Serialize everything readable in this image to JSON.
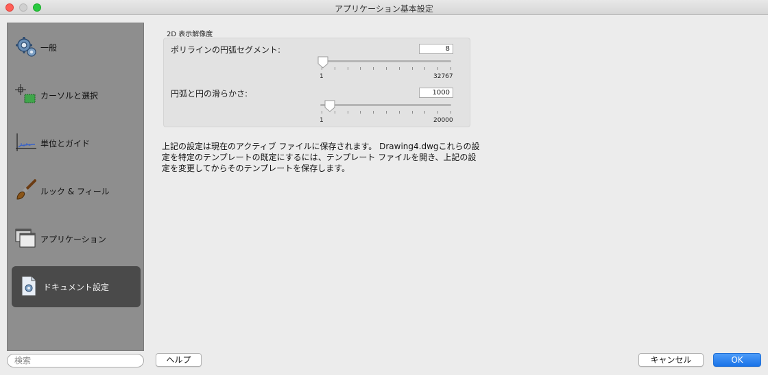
{
  "window": {
    "title": "アプリケーション基本設定"
  },
  "sidebar": {
    "items": [
      {
        "label": "一般",
        "icon": "gear-icon"
      },
      {
        "label": "カーソルと選択",
        "icon": "cursor-selection-icon"
      },
      {
        "label": "単位とガイド",
        "icon": "units-guide-icon"
      },
      {
        "label": "ルック & フィール",
        "icon": "paintbrush-icon"
      },
      {
        "label": "アプリケーション",
        "icon": "windows-icon"
      },
      {
        "label": "ドキュメント設定",
        "icon": "document-icon",
        "active": true
      }
    ],
    "search_placeholder": "検索"
  },
  "display_resolution": {
    "section_title": "2D 表示解像度",
    "polyline": {
      "label": "ポリラインの円弧セグメント:",
      "value": "8",
      "min_label": "1",
      "max_label": "32767",
      "slider_fraction": 0.0
    },
    "smoothness": {
      "label": "円弧と円の滑らかさ:",
      "value": "1000",
      "min_label": "1",
      "max_label": "20000",
      "slider_fraction": 0.05
    }
  },
  "info_text": "上記の設定は現在のアクティブ ファイルに保存されます。 Drawing4.dwgこれらの設定を特定のテンプレートの既定にするには、テンプレート ファイルを開き、上記の設定を変更してからそのテンプレートを保存します。",
  "buttons": {
    "help": "ヘルプ",
    "cancel": "キャンセル",
    "ok": "OK"
  },
  "colors": {
    "accent": "#1a73e8",
    "sidebar_bg": "#8e8e8e",
    "active_item": "#4a4a4a"
  }
}
